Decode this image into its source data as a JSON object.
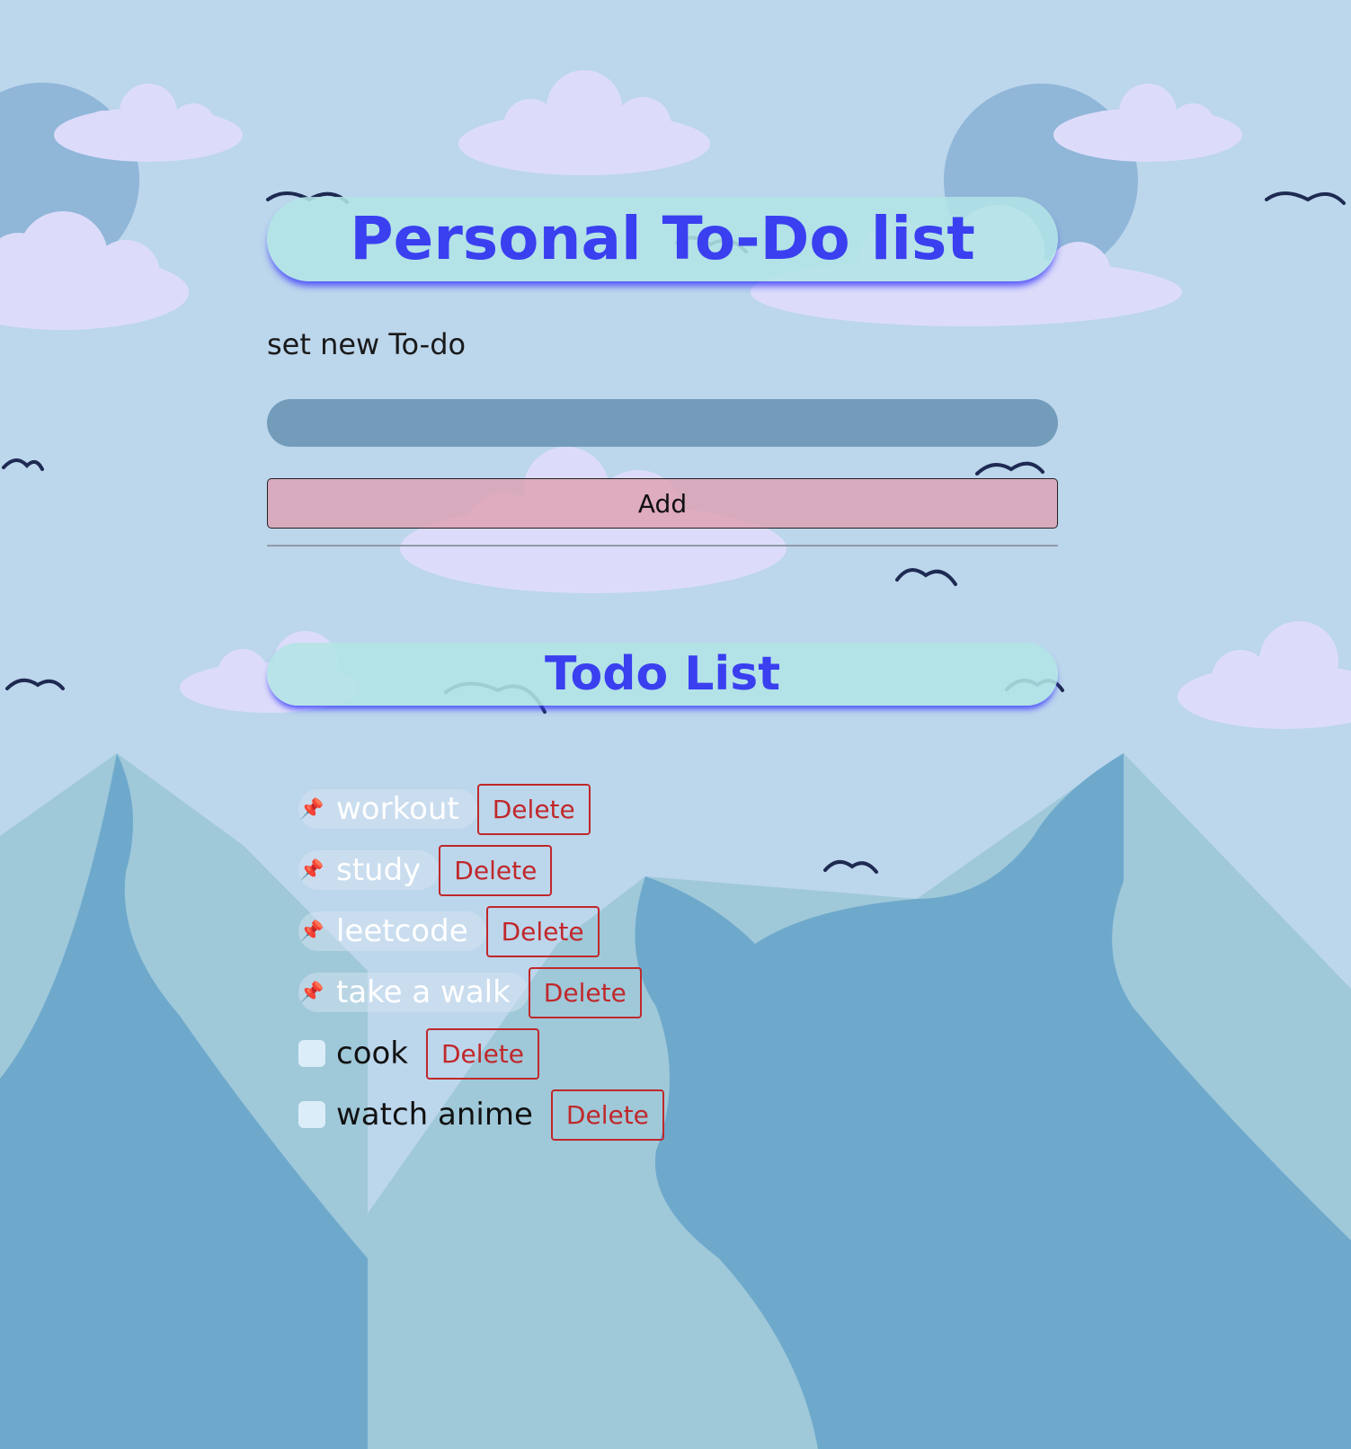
{
  "header": {
    "title": "Personal To-Do list"
  },
  "form": {
    "label": "set new To-do",
    "input_value": "",
    "input_placeholder": "",
    "add_label": "Add"
  },
  "list": {
    "title": "Todo List",
    "delete_label": "Delete",
    "items": [
      {
        "text": "workout",
        "done": true,
        "done_icon": "pushpin-icon"
      },
      {
        "text": "study",
        "done": true,
        "done_icon": "pushpin-icon"
      },
      {
        "text": "leetcode",
        "done": true,
        "done_icon": "pushpin-icon"
      },
      {
        "text": "take a walk",
        "done": true,
        "done_icon": "pushpin-icon"
      },
      {
        "text": "cook",
        "done": false
      },
      {
        "text": "watch anime",
        "done": false
      }
    ]
  },
  "colors": {
    "accent": "#3a3ff0",
    "delete": "#c0282a",
    "input_bg": "#739cbb",
    "add_bg": "#dea0b2"
  }
}
